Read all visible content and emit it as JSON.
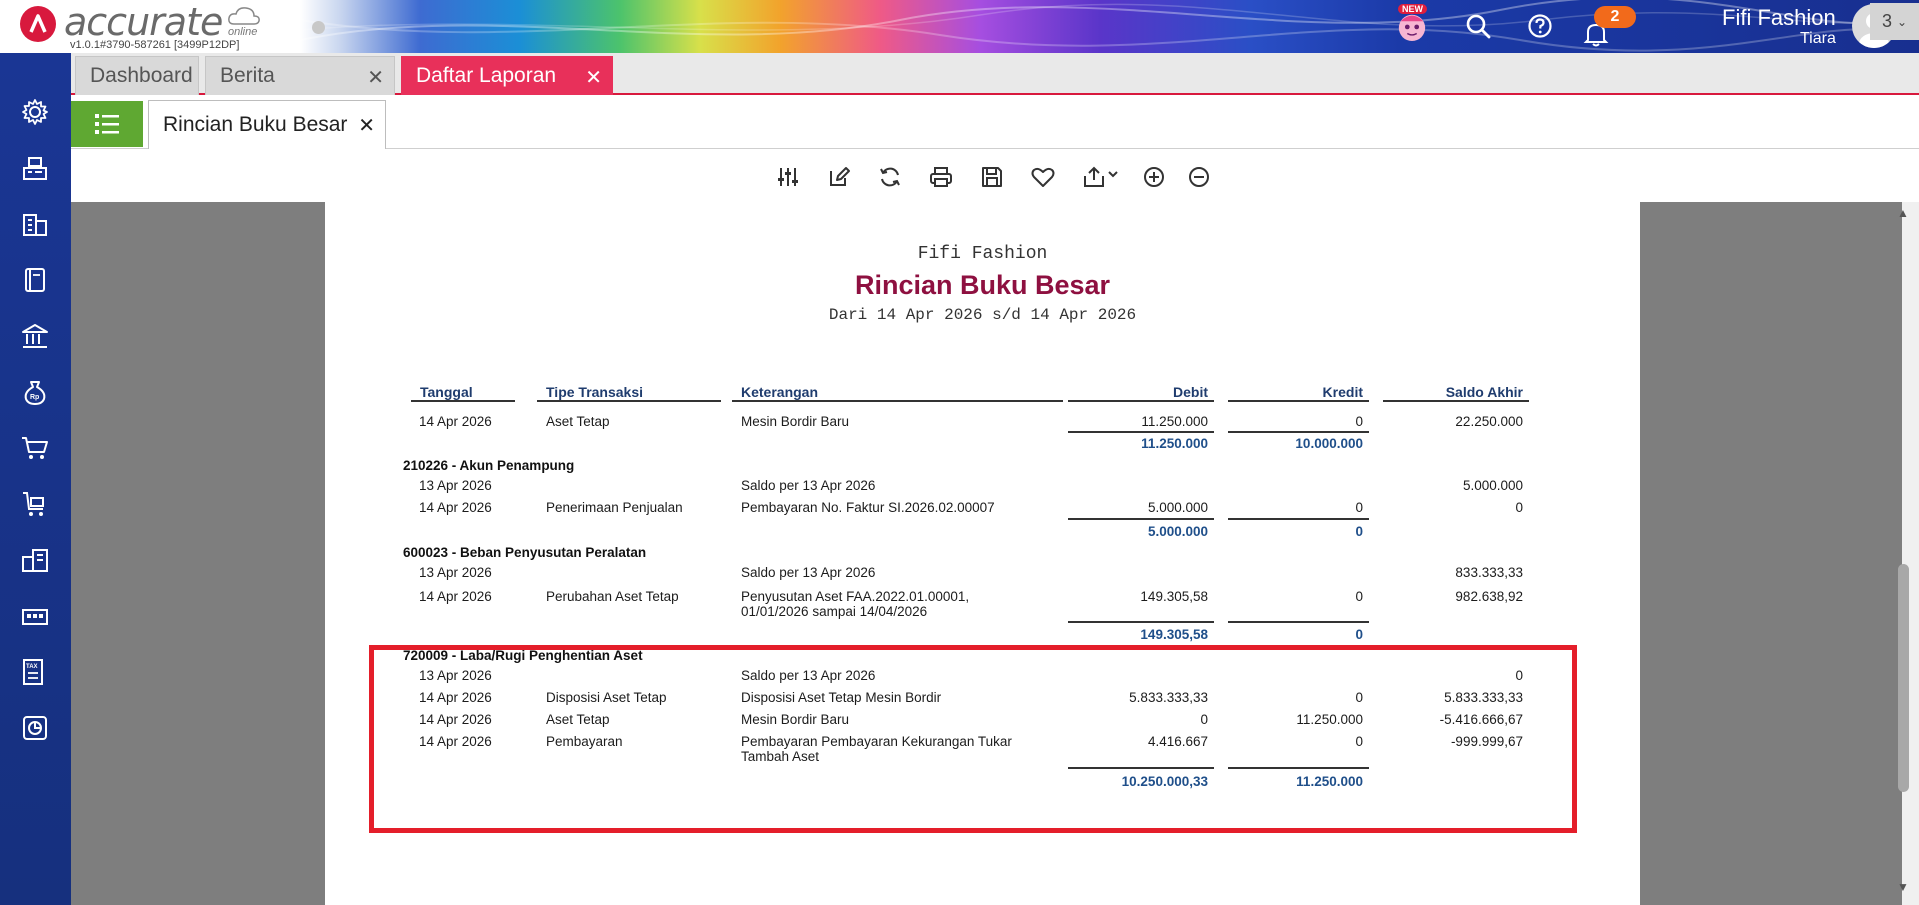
{
  "app": {
    "brand": "accurate",
    "brand_sub": "online",
    "version": "v1.0.1#3790-587261 [3499P12DP]",
    "new_badge": "NEW",
    "notification_count": "2",
    "user_name": "Fifi Fashion",
    "user_sub": "Tiara"
  },
  "tabs": [
    {
      "label": "Dashboard"
    },
    {
      "label": "Berita"
    },
    {
      "label": "Daftar Laporan"
    }
  ],
  "tab_count": "3",
  "subtab": {
    "label": "Rincian Buku Besar"
  },
  "close_glyph": "✕",
  "report": {
    "company": "Fifi Fashion",
    "title": "Rincian Buku Besar",
    "range": "Dari 14 Apr 2026 s/d 14 Apr 2026",
    "columns": {
      "tanggal": "Tanggal",
      "tipe": "Tipe Transaksi",
      "keterangan": "Keterangan",
      "debit": "Debit",
      "kredit": "Kredit",
      "saldo": "Saldo Akhir"
    },
    "top_row": {
      "date": "14 Apr 2026",
      "type": "Aset Tetap",
      "desc": "Mesin Bordir Baru",
      "debit": "11.250.000",
      "kredit": "0",
      "saldo": "22.250.000"
    },
    "top_totals": {
      "debit": "11.250.000",
      "kredit": "10.000.000"
    },
    "group1": {
      "name": "210226 - Akun Penampung",
      "rows": [
        {
          "date": "13 Apr 2026",
          "type": "",
          "desc": "Saldo per 13 Apr 2026",
          "debit": "",
          "kredit": "",
          "saldo": "5.000.000"
        },
        {
          "date": "14 Apr 2026",
          "type": "Penerimaan Penjualan",
          "desc": "Pembayaran No. Faktur SI.2026.02.00007",
          "debit": "5.000.000",
          "kredit": "0",
          "saldo": "0"
        }
      ],
      "totals": {
        "debit": "5.000.000",
        "kredit": "0"
      }
    },
    "group2": {
      "name": "600023 - Beban Penyusutan Peralatan",
      "rows": [
        {
          "date": "13 Apr 2026",
          "type": "",
          "desc": "Saldo per 13 Apr 2026",
          "debit": "",
          "kredit": "",
          "saldo": "833.333,33"
        },
        {
          "date": "14 Apr 2026",
          "type": "Perubahan Aset Tetap",
          "desc": "Penyusutan Aset FAA.2022.01.00001,",
          "desc2": "01/01/2026 sampai 14/04/2026",
          "debit": "149.305,58",
          "kredit": "0",
          "saldo": "982.638,92"
        }
      ],
      "totals": {
        "debit": "149.305,58",
        "kredit": "0"
      }
    },
    "group3": {
      "name": "720009 - Laba/Rugi Penghentian Aset",
      "rows": [
        {
          "date": "13 Apr 2026",
          "type": "",
          "desc": "Saldo per 13 Apr 2026",
          "debit": "",
          "kredit": "",
          "saldo": "0"
        },
        {
          "date": "14 Apr 2026",
          "type": "Disposisi Aset Tetap",
          "desc": "Disposisi Aset Tetap Mesin Bordir",
          "debit": "5.833.333,33",
          "kredit": "0",
          "saldo": "5.833.333,33"
        },
        {
          "date": "14 Apr 2026",
          "type": "Aset Tetap",
          "desc": "Mesin Bordir Baru",
          "debit": "0",
          "kredit": "11.250.000",
          "saldo": "-5.416.666,67"
        },
        {
          "date": "14 Apr 2026",
          "type": "Pembayaran",
          "desc": "Pembayaran Pembayaran Kekurangan Tukar",
          "desc2": "Tambah Aset",
          "debit": "4.416.667",
          "kredit": "0",
          "saldo": "-999.999,67"
        }
      ],
      "totals": {
        "debit": "10.250.000,33",
        "kredit": "11.250.000"
      }
    }
  },
  "colors": {
    "accent": "#e8305a",
    "sidebar": "#1a3694",
    "title": "#8e1040",
    "highlight": "#e41e2a",
    "green": "#5fa832"
  }
}
